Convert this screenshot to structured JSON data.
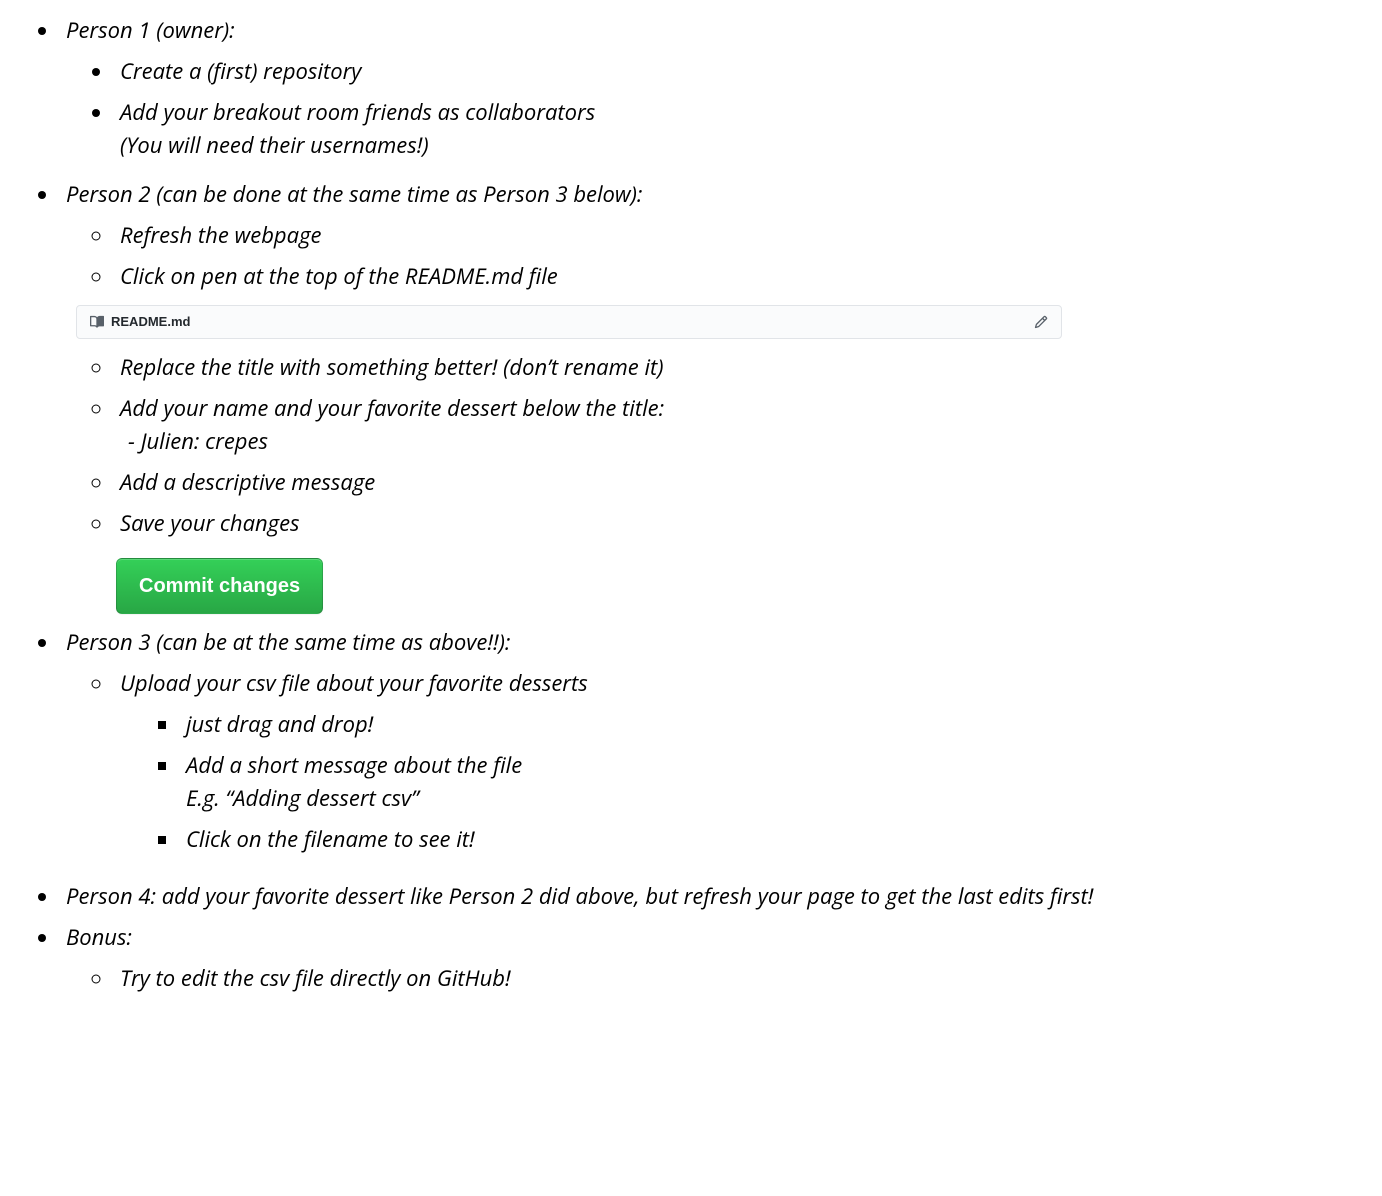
{
  "people": [
    {
      "title": "Person 1 (owner):",
      "bullet_style": "disc",
      "items": [
        {
          "text": "Create a (first) repository"
        },
        {
          "text": "Add your breakout room friends as collaborators",
          "extra": "(You will need their usernames!)"
        }
      ]
    },
    {
      "title": "Person 2 (can be done at the same time as Person 3 below):",
      "bullet_style": "circle",
      "items_a": [
        {
          "text": "Refresh the webpage"
        },
        {
          "text": "Click on pen at the top of the README.md file"
        }
      ],
      "readme_label": "README.md",
      "items_b": [
        {
          "text": "Replace the title with something better! (don’t rename it)"
        },
        {
          "text": "Add your name and your favorite dessert below the title:",
          "dash": "-  Julien: crepes"
        },
        {
          "text": "Add a descriptive message"
        },
        {
          "text": "Save your changes"
        }
      ],
      "commit_label": "Commit changes"
    },
    {
      "title": "Person 3 (can be at the same time as above!!):",
      "bullet_style": "circle",
      "items": [
        {
          "text": "Upload your csv file about your favorite desserts",
          "subitems": [
            {
              "text": "just drag and drop!"
            },
            {
              "text": "Add a short message about the file",
              "eg": "E.g. “Adding dessert csv”"
            },
            {
              "text": "Click on the filename to see it!"
            }
          ]
        }
      ]
    },
    {
      "title": "Person 4: add your favorite dessert like Person 2 did above, but refresh your page to get the last edits first!"
    },
    {
      "title": "Bonus:",
      "bullet_style": "circle",
      "items": [
        {
          "text": "Try to edit the csv file directly on GitHub!"
        }
      ]
    }
  ]
}
